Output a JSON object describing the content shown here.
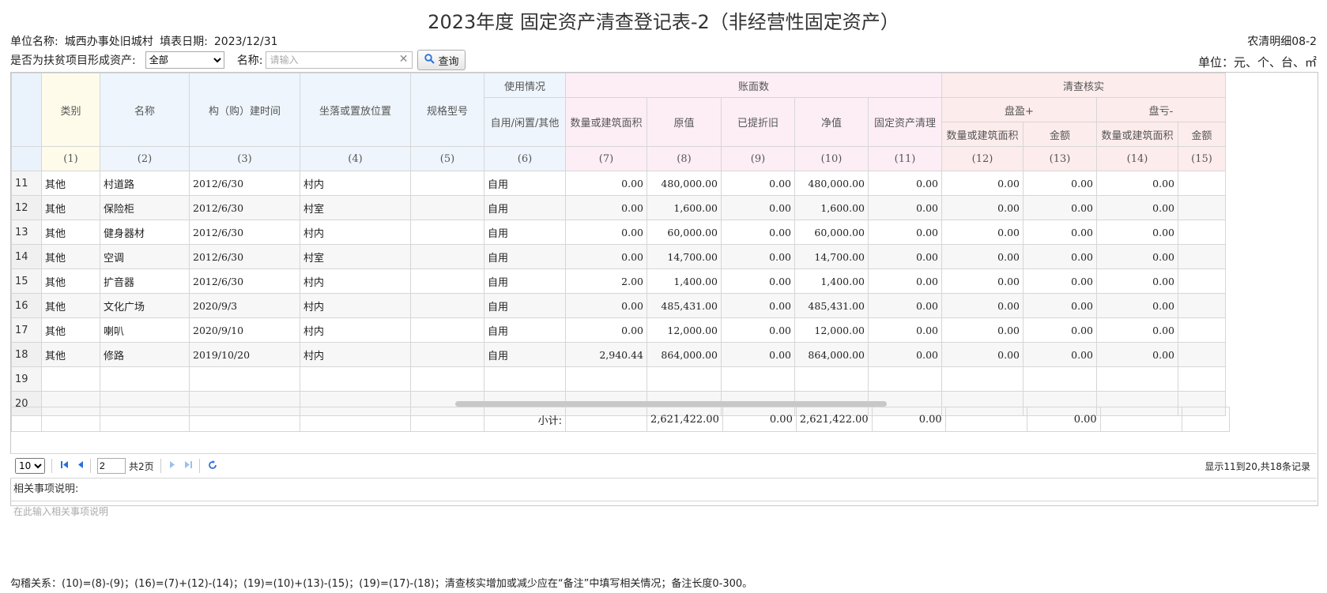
{
  "title": "2023年度 固定资产清查登记表-2（非经营性固定资产）",
  "info": {
    "unit_label": "单位名称:",
    "unit_value": "城西办事处旧城村",
    "date_label": "填表日期:",
    "date_value": "2023/12/31",
    "code": "农清明细08-2",
    "unit_of_measure": "单位：元、个、台、㎡"
  },
  "filter": {
    "poverty_label": "是否为扶贫项目形成资产:",
    "poverty_value": "全部",
    "name_label": "名称:",
    "name_placeholder": "请输入",
    "clear_icon": "✕",
    "query_label": "查询"
  },
  "headers": {
    "category": "类别",
    "name": "名称",
    "build_time": "构（购）建时间",
    "location": "坐落或置放位置",
    "spec": "规格型号",
    "usage_group": "使用情况",
    "usage": "自用/闲置/其他",
    "book_group": "账面数",
    "qty_area": "数量或建筑面积",
    "original": "原值",
    "depreciation": "已提折旧",
    "net": "净值",
    "cleanup": "固定资产清理",
    "verify_group": "清查核实",
    "surplus_group": "盘盈+",
    "surplus_qty": "数量或建筑面积",
    "surplus_amount": "金额",
    "loss_group": "盘亏-",
    "loss_qty": "数量或建筑面积",
    "loss_amount": "金额",
    "idx": [
      "(1)",
      "(2)",
      "(3)",
      "(4)",
      "(5)",
      "(6)",
      "(7)",
      "(8)",
      "(9)",
      "(10)",
      "(11)",
      "(12)",
      "(13)",
      "(14)",
      "(15)"
    ]
  },
  "rows": [
    {
      "n": "11",
      "cat": "其他",
      "name": "村道路",
      "date": "2012/6/30",
      "loc": "村内",
      "spec": "",
      "use": "自用",
      "qty": "0.00",
      "orig": "480,000.00",
      "dep": "0.00",
      "net": "480,000.00",
      "clean": "0.00",
      "sq": "0.00",
      "sa": "0.00",
      "lq": "0.00"
    },
    {
      "n": "12",
      "cat": "其他",
      "name": "保险柜",
      "date": "2012/6/30",
      "loc": "村室",
      "spec": "",
      "use": "自用",
      "qty": "0.00",
      "orig": "1,600.00",
      "dep": "0.00",
      "net": "1,600.00",
      "clean": "0.00",
      "sq": "0.00",
      "sa": "0.00",
      "lq": "0.00"
    },
    {
      "n": "13",
      "cat": "其他",
      "name": "健身器材",
      "date": "2012/6/30",
      "loc": "村内",
      "spec": "",
      "use": "自用",
      "qty": "0.00",
      "orig": "60,000.00",
      "dep": "0.00",
      "net": "60,000.00",
      "clean": "0.00",
      "sq": "0.00",
      "sa": "0.00",
      "lq": "0.00"
    },
    {
      "n": "14",
      "cat": "其他",
      "name": "空调",
      "date": "2012/6/30",
      "loc": "村室",
      "spec": "",
      "use": "自用",
      "qty": "0.00",
      "orig": "14,700.00",
      "dep": "0.00",
      "net": "14,700.00",
      "clean": "0.00",
      "sq": "0.00",
      "sa": "0.00",
      "lq": "0.00"
    },
    {
      "n": "15",
      "cat": "其他",
      "name": "扩音器",
      "date": "2012/6/30",
      "loc": "村内",
      "spec": "",
      "use": "自用",
      "qty": "2.00",
      "orig": "1,400.00",
      "dep": "0.00",
      "net": "1,400.00",
      "clean": "0.00",
      "sq": "0.00",
      "sa": "0.00",
      "lq": "0.00"
    },
    {
      "n": "16",
      "cat": "其他",
      "name": "文化广场",
      "date": "2020/9/3",
      "loc": "村内",
      "spec": "",
      "use": "自用",
      "qty": "0.00",
      "orig": "485,431.00",
      "dep": "0.00",
      "net": "485,431.00",
      "clean": "0.00",
      "sq": "0.00",
      "sa": "0.00",
      "lq": "0.00"
    },
    {
      "n": "17",
      "cat": "其他",
      "name": "喇叭",
      "date": "2020/9/10",
      "loc": "村内",
      "spec": "",
      "use": "自用",
      "qty": "0.00",
      "orig": "12,000.00",
      "dep": "0.00",
      "net": "12,000.00",
      "clean": "0.00",
      "sq": "0.00",
      "sa": "0.00",
      "lq": "0.00"
    },
    {
      "n": "18",
      "cat": "其他",
      "name": "修路",
      "date": "2019/10/20",
      "loc": "村内",
      "spec": "",
      "use": "自用",
      "qty": "2,940.44",
      "orig": "864,000.00",
      "dep": "0.00",
      "net": "864,000.00",
      "clean": "0.00",
      "sq": "0.00",
      "sa": "0.00",
      "lq": "0.00"
    },
    {
      "n": "19",
      "cat": "",
      "name": "",
      "date": "",
      "loc": "",
      "spec": "",
      "use": "",
      "qty": "",
      "orig": "",
      "dep": "",
      "net": "",
      "clean": "",
      "sq": "",
      "sa": "",
      "lq": ""
    },
    {
      "n": "20",
      "cat": "",
      "name": "",
      "date": "",
      "loc": "",
      "spec": "",
      "use": "",
      "qty": "",
      "orig": "",
      "dep": "",
      "net": "",
      "clean": "",
      "sq": "",
      "sa": "",
      "lq": ""
    }
  ],
  "subtotal": {
    "label": "小计:",
    "orig": "2,621,422.00",
    "dep": "0.00",
    "net": "2,621,422.00",
    "clean": "0.00",
    "sa": "0.00"
  },
  "pager": {
    "page_size": "10",
    "current_page": "2",
    "total_pages": "共2页",
    "records": "显示11到20,共18条记录"
  },
  "notes": {
    "label": "相关事项说明:",
    "placeholder": "在此输入相关事项说明"
  },
  "formula": "勾稽关系：(10)=(8)-(9)；(16)=(7)+(12)-(14)；(19)=(10)+(13)-(15)；(19)=(17)-(18)；清查核实增加或减少应在“备注”中填写相关情况；备注长度0-300。"
}
